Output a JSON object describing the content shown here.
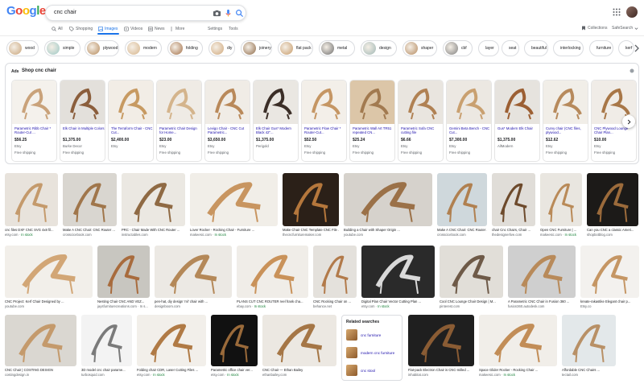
{
  "header": {
    "logo_text": "Google",
    "logo_colors": [
      "#4285F4",
      "#EA4335",
      "#FBBC05",
      "#4285F4",
      "#34A853",
      "#EA4335"
    ],
    "search_query": "cnc chair"
  },
  "tabs": [
    {
      "label": "All",
      "icon": "search-icon"
    },
    {
      "label": "Shopping",
      "icon": "tag-icon"
    },
    {
      "label": "Images",
      "icon": "image-icon",
      "active": true
    },
    {
      "label": "Videos",
      "icon": "play-icon"
    },
    {
      "label": "News",
      "icon": "news-icon"
    },
    {
      "label": "More",
      "icon": "dots-icon"
    }
  ],
  "tools": {
    "settings": "Settings",
    "tools": "Tools"
  },
  "top_right": {
    "collections": "Collections",
    "safesearch": "SafeSearch"
  },
  "chips": [
    "wood",
    "simple",
    "plywood",
    "modern",
    "folding",
    "diy",
    "joinery",
    "flat pack",
    "metal",
    "design",
    "shaper",
    "cbf",
    "layer",
    "seat",
    "beautiful",
    "interlocking",
    "furniture",
    "kerf"
  ],
  "ads": {
    "label": "Ads",
    "title": "Shop cnc chair",
    "items": [
      {
        "title": "Parametric Ribb Chair * Router-Cut ...",
        "price": "$56.25",
        "seller": "Etsy",
        "shipping": "Free shipping"
      },
      {
        "title": "Elk Chair in Multiple Colors",
        "price": "$1,375.00",
        "seller": "Burke Decor",
        "shipping": "Free shipping"
      },
      {
        "title": "The Terraform Chair - CNC Cut...",
        "price": "$2,400.00",
        "seller": "Etsy",
        "shipping": ""
      },
      {
        "title": "Parametric Chair Design for Home...",
        "price": "$23.00",
        "seller": "Etsy",
        "shipping": "Free shipping"
      },
      {
        "title": "Levigo Chair - CNC Cut Parametric...",
        "price": "$3,650.00",
        "seller": "Etsy",
        "shipping": "Free shipping"
      },
      {
        "title": "Elk Chair Gus* Modern Black 42\"...",
        "price": "$1,375.00",
        "seller": "Perigold",
        "shipping": ""
      },
      {
        "title": "Parametric Flow Chair * Router-Cut...",
        "price": "$52.50",
        "seller": "Etsy",
        "shipping": "Free shipping"
      },
      {
        "title": "Parametric Wall Art TR51 repeated CN...",
        "price": "$25.24",
        "seller": "Etsy",
        "shipping": "Free shipping"
      },
      {
        "title": "Parametric Sofa CNC cutting file",
        "price": "$6.66",
        "seller": "Etsy",
        "shipping": "Free shipping"
      },
      {
        "title": "Gemini Beta Bench - CNC Cut...",
        "price": "$7,300.00",
        "seller": "Etsy",
        "shipping": "Free shipping"
      },
      {
        "title": "Gus* Modern Elk Chair",
        "price": "$1,375.00",
        "seller": "AllModern",
        "shipping": ""
      },
      {
        "title": "Curvy chair (CNC files, plywood...",
        "price": "$12.62",
        "seller": "Etsy",
        "shipping": "Free shipping"
      },
      {
        "title": "CNC Plywood Lounge Chair Plan...",
        "price": "$10.00",
        "seller": "Etsy",
        "shipping": "Free shipping"
      }
    ]
  },
  "images": {
    "row1": [
      {
        "title": "cnc files DXF CNC SVG 4x8 fil...",
        "source": "etsy.com",
        "stock": "In stock",
        "colors": [
          "#e8e3dc",
          "#c49a6c"
        ]
      },
      {
        "title": "Make A CNC Chair: CNC Router ...",
        "source": "crosscicebook.com",
        "stock": "",
        "colors": [
          "#d9d6d0",
          "#a0764b"
        ]
      },
      {
        "title": "PRC - Chair Made With CNC Router ...",
        "source": "instructables.com",
        "stock": "",
        "colors": [
          "#ebe8e2",
          "#8f6a44"
        ]
      },
      {
        "title": "Lover Rocker - Rocking Chair - Furniture ...",
        "source": "makeesic.com",
        "stock": "In stock",
        "colors": [
          "#f1eee8",
          "#c89560"
        ]
      },
      {
        "title": "Make Chair CNC Template CNC File ...",
        "source": "thecncfurnituremaker.com",
        "stock": "",
        "colors": [
          "#2b2018",
          "#b5773c"
        ]
      },
      {
        "title": "Building a Chair with Shaper Origin ...",
        "source": "youtube.com",
        "stock": "",
        "colors": [
          "#d6d2cc",
          "#9b7148"
        ]
      },
      {
        "title": "Make A CNC Chair: CNC Router ...",
        "source": "crosscicebook.com",
        "stock": "",
        "colors": [
          "#cfd8dc",
          "#b08050"
        ]
      },
      {
        "title": "chair Cnc Chairs, Chair ...",
        "source": "thedesignerlive.com",
        "stock": "",
        "colors": [
          "#e0ddd8",
          "#6d4a2c"
        ]
      },
      {
        "title": "Open CNC Furniture | ...",
        "source": "makeesic.com",
        "stock": "In stock",
        "colors": [
          "#e9e6e0",
          "#b98a58"
        ]
      },
      {
        "title": "Can you CNC a classic Ameri...",
        "source": "shopbotblog.com",
        "stock": "",
        "colors": [
          "#1c1a18",
          "#9c6b3b"
        ]
      }
    ],
    "row2": [
      {
        "title": "CNC Project: Kerf Chair Designed by ...",
        "source": "youtube.com",
        "stock": "",
        "colors": [
          "#f2efea",
          "#d2a676"
        ]
      },
      {
        "title": "Nesting Chair CNC AND VEZ...",
        "source": "jaysfurniturecreations.com · In s...",
        "stock": "",
        "colors": [
          "#c8c6c0",
          "#a86b3d"
        ]
      },
      {
        "title": "pen-hat, diy design 'ml' chair with ...",
        "source": "designboom.com",
        "stock": "",
        "colors": [
          "#ece9e4",
          "#b48858"
        ]
      },
      {
        "title": "PLANS CUT CNC ROUTER reel frank cha...",
        "source": "ebay.com",
        "stock": "In stock",
        "colors": [
          "#f0ede8",
          "#c9925a"
        ]
      },
      {
        "title": "CNC Rocking Chair on ...",
        "source": "behance.net",
        "stock": "",
        "colors": [
          "#e4e1dc",
          "#b27a4a"
        ]
      },
      {
        "title": "Digital Plan Chair Vector Cutting Plan ...",
        "source": "etsy.com",
        "stock": "In stock",
        "colors": [
          "#2a2a2a",
          "#d9d9d9"
        ]
      },
      {
        "title": "Cool CNC Lounge Chair Design | M...",
        "source": "pinterest.com",
        "stock": "",
        "colors": [
          "#e1ded8",
          "#6e5a48"
        ]
      },
      {
        "title": "A Parametric CNC Chair in Fusion 360 ...",
        "source": "fusion360.autodesk.com",
        "stock": "",
        "colors": [
          "#cfcfcf",
          "#b88a5a"
        ]
      },
      {
        "title": "kreate-rakastike Elegant chair p...",
        "source": "Etsy.co",
        "stock": "",
        "colors": [
          "#f3f1ee",
          "#c59664"
        ]
      }
    ],
    "row3": [
      {
        "title": "CNC Chair | COSTING DESIGN",
        "source": "costingdesign.in",
        "stock": "",
        "colors": [
          "#dad7d1",
          "#c49a6c"
        ]
      },
      {
        "title": "3D model cnc chair parame...",
        "source": "turbosquid.com",
        "stock": "",
        "colors": [
          "#f3f3f3",
          "#7a7a7a"
        ]
      },
      {
        "title": "Folding chair CDR, Laser Cutting Files ...",
        "source": "etsy.com",
        "stock": "In stock",
        "colors": [
          "#f2efea",
          "#b07a45"
        ]
      },
      {
        "title": "Parametric office chair ver...",
        "source": "etsy.com",
        "stock": "In stock",
        "colors": [
          "#111111",
          "#9a6a3a"
        ]
      },
      {
        "title": "CNC Chair — Ethan Bailey",
        "source": "ethanbailey.com",
        "stock": "",
        "colors": [
          "#ece8e2",
          "#a57646"
        ]
      },
      {
        "title": "Flat-pack Electron Chair is CNC-milled ...",
        "source": "inhabitat.com",
        "stock": "",
        "colors": [
          "#1f1f1f",
          "#8a5c34"
        ]
      },
      {
        "title": "Space Glider Rocker - Rocking Chair ...",
        "source": "makeesic.com",
        "stock": "In stock",
        "colors": [
          "#f1eee9",
          "#c28d57"
        ]
      },
      {
        "title": "Affordable CNC Chairs ...",
        "source": "tectail.com",
        "stock": "",
        "colors": [
          "#e3e8ea",
          "#b89066"
        ]
      }
    ]
  },
  "related": {
    "title": "Related searches",
    "items": [
      "cnc furniture",
      "modern cnc furniture",
      "cnc stool"
    ]
  }
}
